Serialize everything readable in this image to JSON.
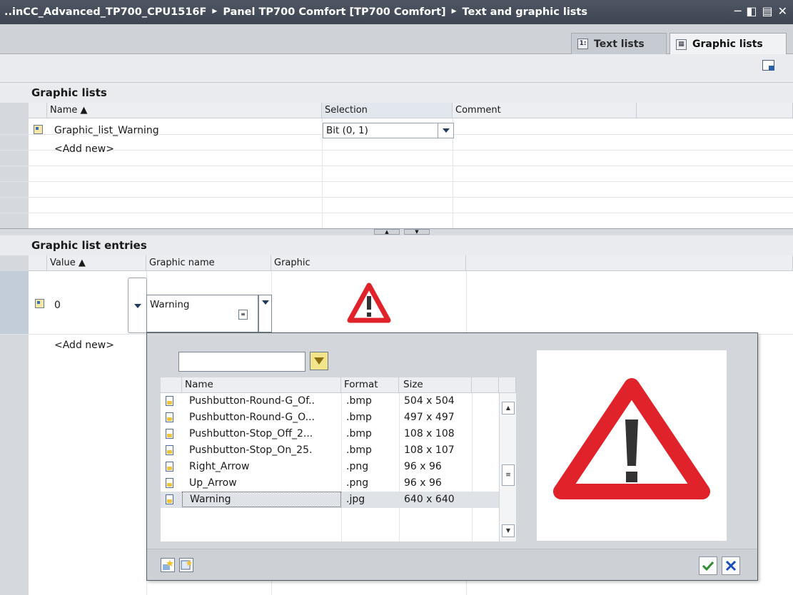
{
  "title": {
    "segments": [
      "..inCC_Advanced_TP700_CPU1516F",
      "Panel TP700 Comfort [TP700 Comfort]",
      "Text and graphic lists"
    ],
    "separator": "▶"
  },
  "tabs": [
    {
      "label": "Text lists",
      "active": false,
      "icon": "text-list-icon"
    },
    {
      "label": "Graphic lists",
      "active": true,
      "icon": "graphic-list-icon"
    }
  ],
  "graphic_lists": {
    "heading": "Graphic lists",
    "columns": [
      "Name ▲",
      "Selection",
      "Comment"
    ],
    "rows": [
      {
        "name": "Graphic_list_Warning",
        "selection": "Bit (0, 1)",
        "comment": ""
      }
    ],
    "add_new": "<Add new>"
  },
  "entries": {
    "heading": "Graphic list entries",
    "columns": [
      "Value ▲",
      "Graphic name",
      "Graphic"
    ],
    "rows": [
      {
        "value": "0",
        "graphic_name": "Warning"
      }
    ],
    "add_new": "<Add new>"
  },
  "popup": {
    "filter_value": "",
    "columns": [
      "Name",
      "Format",
      "Size"
    ],
    "items": [
      {
        "name": "Pushbutton-Round-G_Of..",
        "format": ".bmp",
        "size": "504 x 504"
      },
      {
        "name": "Pushbutton-Round-G_O...",
        "format": ".bmp",
        "size": "497 x 497"
      },
      {
        "name": "Pushbutton-Stop_Off_2...",
        "format": ".bmp",
        "size": "108 x 108"
      },
      {
        "name": "Pushbutton-Stop_On_25.",
        "format": ".bmp",
        "size": "108 x 107"
      },
      {
        "name": "Right_Arrow",
        "format": ".png",
        "size": "96 x 96"
      },
      {
        "name": "Up_Arrow",
        "format": ".png",
        "size": "96 x 96"
      },
      {
        "name": "Warning",
        "format": ".jpg",
        "size": "640 x 640"
      }
    ],
    "selected_index": 6
  },
  "colors": {
    "titlebar": "#464d5a",
    "warning_red": "#e0232a",
    "ok_green": "#2e8b2e",
    "cancel_blue": "#1b4fbf"
  }
}
